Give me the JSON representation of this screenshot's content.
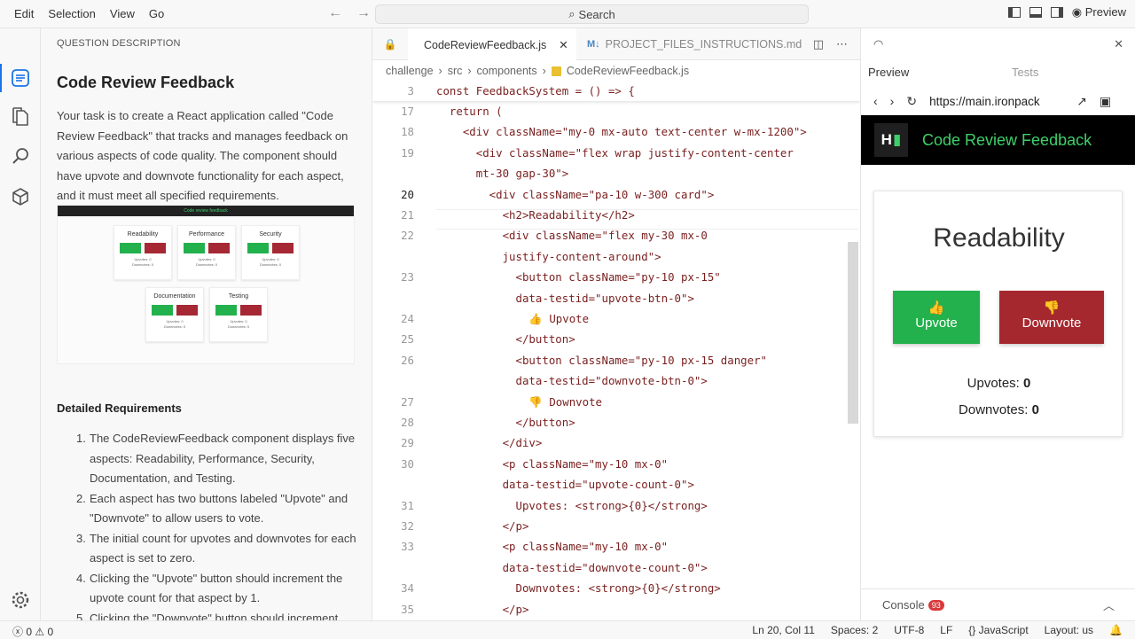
{
  "menu": [
    "Edit",
    "Selection",
    "View",
    "Go"
  ],
  "search": {
    "label": "Search"
  },
  "preview_toggle": "Preview",
  "sidebar": {
    "header": "QUESTION DESCRIPTION",
    "title": "Code Review Feedback",
    "description": "Your task is to create a React application called \"Code Review Feedback\" that tracks and manages feedback on various aspects of code quality. The component should have upvote and downvote functionality for each aspect, and it must meet all specified requirements.",
    "thumbnail": {
      "bar_title": "Code review feedback",
      "cards": [
        "Readability",
        "Performance",
        "Security",
        "Documentation",
        "Testing"
      ],
      "upvotes": "Upvotes: 0",
      "downvotes": "Downvotes: 0"
    },
    "requirements_title": "Detailed Requirements",
    "requirements": [
      {
        "n": "1.",
        "text": "The CodeReviewFeedback component displays five aspects: Readability, Performance, Security, Documentation, and Testing."
      },
      {
        "n": "2.",
        "text": "Each aspect has two buttons labeled \"Upvote\" and \"Downvote\" to allow users to vote."
      },
      {
        "n": "3.",
        "text": "The initial count for upvotes and downvotes for each aspect is set to zero."
      },
      {
        "n": "4.",
        "text": "Clicking the \"Upvote\" button should increment the upvote count for that aspect by 1."
      },
      {
        "n": "5.",
        "text": "Clicking the \"Downvote\" button should increment"
      }
    ]
  },
  "editor": {
    "tabs": [
      {
        "label": "CodeReviewFeedback.js",
        "active": true
      },
      {
        "label": "PROJECT_FILES_INSTRUCTIONS.md",
        "active": false
      }
    ],
    "breadcrumb": [
      "challenge",
      "src",
      "components",
      "CodeReviewFeedback.js"
    ],
    "sticky": {
      "ln": "3",
      "text": "const FeedbackSystem = () => {"
    },
    "lines": [
      {
        "ln": "17",
        "text": "  return ("
      },
      {
        "ln": "18",
        "text": "    <div className=\"my-0 mx-auto text-center w-mx-1200\">"
      },
      {
        "ln": "19",
        "text": "      <div className=\"flex wrap justify-content-center"
      },
      {
        "ln": "",
        "text": "      mt-30 gap-30\">"
      },
      {
        "ln": "20",
        "text": "        <div className=\"pa-10 w-300 card\">"
      },
      {
        "ln": "21",
        "text": "          <h2>Readability</h2>"
      },
      {
        "ln": "22",
        "text": "          <div className=\"flex my-30 mx-0"
      },
      {
        "ln": "",
        "text": "          justify-content-around\">"
      },
      {
        "ln": "23",
        "text": "            <button className=\"py-10 px-15\""
      },
      {
        "ln": "",
        "text": "            data-testid=\"upvote-btn-0\">"
      },
      {
        "ln": "24",
        "text": "              👍 Upvote"
      },
      {
        "ln": "25",
        "text": "            </button>"
      },
      {
        "ln": "26",
        "text": "            <button className=\"py-10 px-15 danger\""
      },
      {
        "ln": "",
        "text": "            data-testid=\"downvote-btn-0\">"
      },
      {
        "ln": "27",
        "text": "              👎 Downvote"
      },
      {
        "ln": "28",
        "text": "            </button>"
      },
      {
        "ln": "29",
        "text": "          </div>"
      },
      {
        "ln": "30",
        "text": "          <p className=\"my-10 mx-0\""
      },
      {
        "ln": "",
        "text": "          data-testid=\"upvote-count-0\">"
      },
      {
        "ln": "31",
        "text": "            Upvotes: <strong>{0}</strong>"
      },
      {
        "ln": "32",
        "text": "          </p>"
      },
      {
        "ln": "33",
        "text": "          <p className=\"my-10 mx-0\""
      },
      {
        "ln": "",
        "text": "          data-testid=\"downvote-count-0\">"
      },
      {
        "ln": "34",
        "text": "            Downvotes: <strong>{0}</strong>"
      },
      {
        "ln": "35",
        "text": "          </p>"
      }
    ]
  },
  "preview": {
    "tabs": [
      "Preview",
      "Tests"
    ],
    "url": "https://main.ironpack",
    "logo": "H",
    "app_title": "Code Review Feedback",
    "card_title": "Readability",
    "upvote_label": "Upvote",
    "downvote_label": "Downvote",
    "upvote_emoji": "👍",
    "downvote_emoji": "👎",
    "upvotes_label": "Upvotes:",
    "upvotes_value": "0",
    "downvotes_label": "Downvotes:",
    "downvotes_value": "0",
    "console_label": "Console",
    "console_count": "93"
  },
  "status": {
    "problems": "0",
    "warnings": "0",
    "position": "Ln 20, Col 11",
    "spaces": "Spaces: 2",
    "encoding": "UTF-8",
    "eol": "LF",
    "language": "JavaScript",
    "layout": "Layout: us"
  },
  "colors": {
    "accent": "#3ecf6a",
    "upvote": "#22b14c",
    "downvote": "#a6282f"
  }
}
